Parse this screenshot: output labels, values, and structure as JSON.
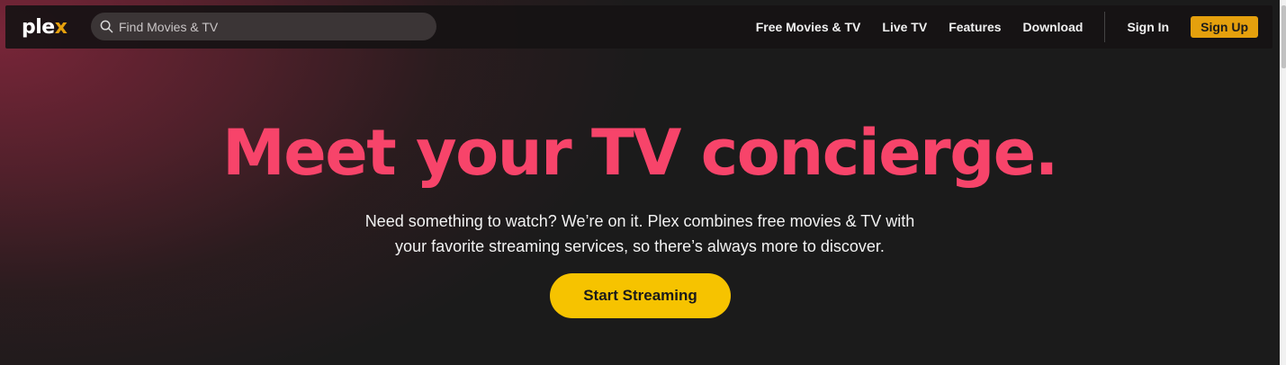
{
  "brand": {
    "logo_text_main": "ple",
    "logo_text_accent": "x",
    "accent_color": "#e5a00d",
    "headline_color": "#f7446a",
    "cta_color": "#f6c300"
  },
  "search": {
    "placeholder": "Find Movies & TV",
    "icon": "search-icon"
  },
  "nav": {
    "links": [
      "Free Movies & TV",
      "Live TV",
      "Features",
      "Download"
    ],
    "sign_in": "Sign In",
    "sign_up": "Sign Up"
  },
  "hero": {
    "headline": "Meet your TV concierge.",
    "subtext_line1": "Need something to watch? We’re on it. Plex combines free movies & TV with",
    "subtext_line2": "your favorite streaming services, so there’s always more to discover.",
    "cta_label": "Start Streaming"
  }
}
